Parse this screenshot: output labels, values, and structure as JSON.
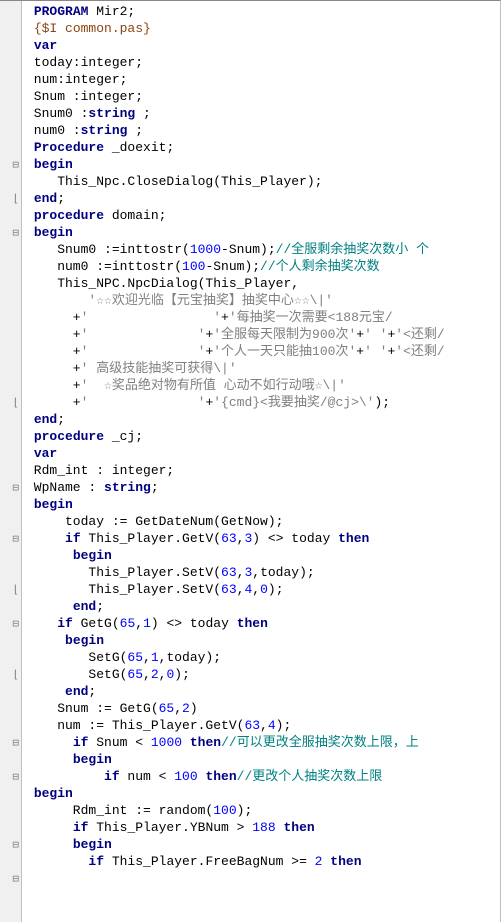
{
  "gutter": [
    "",
    "",
    "",
    "",
    "",
    "",
    "",
    "",
    "",
    "⊟",
    "",
    "⌊",
    "",
    "⊟",
    "",
    "",
    "",
    "",
    "",
    "",
    "",
    "",
    "",
    "⌊",
    "",
    "",
    "",
    "",
    "⊟",
    "",
    "",
    "⊟",
    "",
    "",
    "⌊",
    "",
    "⊟",
    "",
    "",
    "⌊",
    "",
    "",
    "",
    "⊟",
    "",
    "⊟",
    "",
    "",
    "",
    "⊟",
    "",
    "⊟"
  ],
  "lines": [
    [
      {
        "t": " ",
        "c": ""
      },
      {
        "t": "PROGRAM",
        "c": "kw"
      },
      {
        "t": " Mir2;",
        "c": "id"
      }
    ],
    [
      {
        "t": " ",
        "c": ""
      },
      {
        "t": "{$I common.pas}",
        "c": "dir"
      }
    ],
    [
      {
        "t": " ",
        "c": ""
      },
      {
        "t": "var",
        "c": "kw"
      }
    ],
    [
      {
        "t": " today:integer;",
        "c": "id"
      }
    ],
    [
      {
        "t": " num:integer;",
        "c": "id"
      }
    ],
    [
      {
        "t": " Snum :integer;",
        "c": "id"
      }
    ],
    [
      {
        "t": " Snum0 :",
        "c": "id"
      },
      {
        "t": "string",
        "c": "kw"
      },
      {
        "t": " ;",
        "c": "id"
      }
    ],
    [
      {
        "t": " num0 :",
        "c": "id"
      },
      {
        "t": "string",
        "c": "kw"
      },
      {
        "t": " ;",
        "c": "id"
      }
    ],
    [
      {
        "t": " ",
        "c": ""
      },
      {
        "t": "Procedure",
        "c": "kw"
      },
      {
        "t": " _doexit;",
        "c": "id"
      }
    ],
    [
      {
        "t": " ",
        "c": ""
      },
      {
        "t": "begin",
        "c": "kw"
      }
    ],
    [
      {
        "t": "    This_Npc.CloseDialog(This_Player);",
        "c": "id"
      }
    ],
    [
      {
        "t": " ",
        "c": ""
      },
      {
        "t": "end",
        "c": "kw"
      },
      {
        "t": ";",
        "c": "id"
      }
    ],
    [
      {
        "t": " ",
        "c": ""
      },
      {
        "t": "procedure",
        "c": "kw"
      },
      {
        "t": " domain;",
        "c": "id"
      }
    ],
    [
      {
        "t": " ",
        "c": ""
      },
      {
        "t": "begin",
        "c": "kw"
      }
    ],
    [
      {
        "t": "    Snum0 :=inttostr(",
        "c": "id"
      },
      {
        "t": "1000",
        "c": "num"
      },
      {
        "t": "-Snum);",
        "c": "id"
      },
      {
        "t": "//全服剩余抽奖次数小 个",
        "c": "cmt"
      }
    ],
    [
      {
        "t": "    num0 :=inttostr(",
        "c": "id"
      },
      {
        "t": "100",
        "c": "num"
      },
      {
        "t": "-Snum);",
        "c": "id"
      },
      {
        "t": "//个人剩余抽奖次数",
        "c": "cmt"
      }
    ],
    [
      {
        "t": "    This_NPC.NpcDialog(This_Player,",
        "c": "id"
      }
    ],
    [
      {
        "t": "        ",
        "c": ""
      },
      {
        "t": "'☆☆欢迎光临【元宝抽奖】抽奖中心☆☆\\|'",
        "c": "str"
      }
    ],
    [
      {
        "t": "      +",
        "c": "id"
      },
      {
        "t": "'                '",
        "c": "str"
      },
      {
        "t": "+",
        "c": "id"
      },
      {
        "t": "'每抽奖一次需要<188元宝/",
        "c": "str"
      }
    ],
    [
      {
        "t": "      +",
        "c": "id"
      },
      {
        "t": "'              '",
        "c": "str"
      },
      {
        "t": "+",
        "c": "id"
      },
      {
        "t": "'全服每天限制为900次'",
        "c": "str"
      },
      {
        "t": "+",
        "c": "id"
      },
      {
        "t": "' '",
        "c": "str"
      },
      {
        "t": "+",
        "c": "id"
      },
      {
        "t": "'<还剩/",
        "c": "str"
      }
    ],
    [
      {
        "t": "      +",
        "c": "id"
      },
      {
        "t": "'              '",
        "c": "str"
      },
      {
        "t": "+",
        "c": "id"
      },
      {
        "t": "'个人一天只能抽100次'",
        "c": "str"
      },
      {
        "t": "+",
        "c": "id"
      },
      {
        "t": "' '",
        "c": "str"
      },
      {
        "t": "+",
        "c": "id"
      },
      {
        "t": "'<还剩/",
        "c": "str"
      }
    ],
    [
      {
        "t": "      +",
        "c": "id"
      },
      {
        "t": "' 高级技能抽奖可获得\\|'",
        "c": "str"
      }
    ],
    [
      {
        "t": "      +",
        "c": "id"
      },
      {
        "t": "'  ☆奖品绝对物有所值 心动不如行动哦☆\\|'",
        "c": "str"
      }
    ],
    [
      {
        "t": "      +",
        "c": "id"
      },
      {
        "t": "'              '",
        "c": "str"
      },
      {
        "t": "+",
        "c": "id"
      },
      {
        "t": "'{cmd}<我要抽奖/@cj>\\'",
        "c": "str"
      },
      {
        "t": ");",
        "c": "id"
      }
    ],
    [
      {
        "t": " ",
        "c": ""
      },
      {
        "t": "end",
        "c": "kw"
      },
      {
        "t": ";",
        "c": "id"
      }
    ],
    [
      {
        "t": " ",
        "c": ""
      },
      {
        "t": "procedure",
        "c": "kw"
      },
      {
        "t": " _cj;",
        "c": "id"
      }
    ],
    [
      {
        "t": " ",
        "c": ""
      },
      {
        "t": "var",
        "c": "kw"
      }
    ],
    [
      {
        "t": " Rdm_int : integer;",
        "c": "id"
      }
    ],
    [
      {
        "t": " WpName : ",
        "c": "id"
      },
      {
        "t": "string",
        "c": "kw"
      },
      {
        "t": ";",
        "c": "id"
      }
    ],
    [
      {
        "t": " ",
        "c": ""
      },
      {
        "t": "begin",
        "c": "kw"
      }
    ],
    [
      {
        "t": "     today := GetDateNum(GetNow);",
        "c": "id"
      }
    ],
    [
      {
        "t": "     ",
        "c": ""
      },
      {
        "t": "if",
        "c": "kw"
      },
      {
        "t": " This_Player.GetV(",
        "c": "id"
      },
      {
        "t": "63",
        "c": "num"
      },
      {
        "t": ",",
        "c": "id"
      },
      {
        "t": "3",
        "c": "num"
      },
      {
        "t": ") <> today ",
        "c": "id"
      },
      {
        "t": "then",
        "c": "kw"
      }
    ],
    [
      {
        "t": "      ",
        "c": ""
      },
      {
        "t": "begin",
        "c": "kw"
      }
    ],
    [
      {
        "t": "        This_Player.SetV(",
        "c": "id"
      },
      {
        "t": "63",
        "c": "num"
      },
      {
        "t": ",",
        "c": "id"
      },
      {
        "t": "3",
        "c": "num"
      },
      {
        "t": ",today);",
        "c": "id"
      }
    ],
    [
      {
        "t": "        This_Player.SetV(",
        "c": "id"
      },
      {
        "t": "63",
        "c": "num"
      },
      {
        "t": ",",
        "c": "id"
      },
      {
        "t": "4",
        "c": "num"
      },
      {
        "t": ",",
        "c": "id"
      },
      {
        "t": "0",
        "c": "num"
      },
      {
        "t": ");",
        "c": "id"
      }
    ],
    [
      {
        "t": "      ",
        "c": ""
      },
      {
        "t": "end",
        "c": "kw"
      },
      {
        "t": ";",
        "c": "id"
      }
    ],
    [
      {
        "t": "    ",
        "c": ""
      },
      {
        "t": "if",
        "c": "kw"
      },
      {
        "t": " GetG(",
        "c": "id"
      },
      {
        "t": "65",
        "c": "num"
      },
      {
        "t": ",",
        "c": "id"
      },
      {
        "t": "1",
        "c": "num"
      },
      {
        "t": ") <> today ",
        "c": "id"
      },
      {
        "t": "then",
        "c": "kw"
      }
    ],
    [
      {
        "t": "     ",
        "c": ""
      },
      {
        "t": "begin",
        "c": "kw"
      }
    ],
    [
      {
        "t": "        SetG(",
        "c": "id"
      },
      {
        "t": "65",
        "c": "num"
      },
      {
        "t": ",",
        "c": "id"
      },
      {
        "t": "1",
        "c": "num"
      },
      {
        "t": ",today);",
        "c": "id"
      }
    ],
    [
      {
        "t": "        SetG(",
        "c": "id"
      },
      {
        "t": "65",
        "c": "num"
      },
      {
        "t": ",",
        "c": "id"
      },
      {
        "t": "2",
        "c": "num"
      },
      {
        "t": ",",
        "c": "id"
      },
      {
        "t": "0",
        "c": "num"
      },
      {
        "t": ");",
        "c": "id"
      }
    ],
    [
      {
        "t": "     ",
        "c": ""
      },
      {
        "t": "end",
        "c": "kw"
      },
      {
        "t": ";",
        "c": "id"
      }
    ],
    [
      {
        "t": "    Snum := GetG(",
        "c": "id"
      },
      {
        "t": "65",
        "c": "num"
      },
      {
        "t": ",",
        "c": "id"
      },
      {
        "t": "2",
        "c": "num"
      },
      {
        "t": ")",
        "c": "id"
      }
    ],
    [
      {
        "t": "    num := This_Player.GetV(",
        "c": "id"
      },
      {
        "t": "63",
        "c": "num"
      },
      {
        "t": ",",
        "c": "id"
      },
      {
        "t": "4",
        "c": "num"
      },
      {
        "t": ");",
        "c": "id"
      }
    ],
    [
      {
        "t": "      ",
        "c": ""
      },
      {
        "t": "if",
        "c": "kw"
      },
      {
        "t": " Snum < ",
        "c": "id"
      },
      {
        "t": "1000",
        "c": "num"
      },
      {
        "t": " ",
        "c": ""
      },
      {
        "t": "then",
        "c": "kw"
      },
      {
        "t": "//可以更改全服抽奖次数上限，上",
        "c": "cmt"
      }
    ],
    [
      {
        "t": "      ",
        "c": ""
      },
      {
        "t": "begin",
        "c": "kw"
      }
    ],
    [
      {
        "t": "          ",
        "c": ""
      },
      {
        "t": "if",
        "c": "kw"
      },
      {
        "t": " num < ",
        "c": "id"
      },
      {
        "t": "100",
        "c": "num"
      },
      {
        "t": " ",
        "c": ""
      },
      {
        "t": "then",
        "c": "kw"
      },
      {
        "t": "//更改个人抽奖次数上限",
        "c": "cmt"
      }
    ],
    [
      {
        "t": " ",
        "c": ""
      },
      {
        "t": "begin",
        "c": "kw"
      }
    ],
    [
      {
        "t": "      Rdm_int := random(",
        "c": "id"
      },
      {
        "t": "100",
        "c": "num"
      },
      {
        "t": ");",
        "c": "id"
      }
    ],
    [
      {
        "t": "      ",
        "c": ""
      },
      {
        "t": "if",
        "c": "kw"
      },
      {
        "t": " This_Player.YBNum > ",
        "c": "id"
      },
      {
        "t": "188",
        "c": "num"
      },
      {
        "t": " ",
        "c": ""
      },
      {
        "t": "then",
        "c": "kw"
      }
    ],
    [
      {
        "t": "      ",
        "c": ""
      },
      {
        "t": "begin",
        "c": "kw"
      }
    ],
    [
      {
        "t": "        ",
        "c": ""
      },
      {
        "t": "if",
        "c": "kw"
      },
      {
        "t": " This_Player.FreeBagNum >= ",
        "c": "id"
      },
      {
        "t": "2",
        "c": "num"
      },
      {
        "t": " ",
        "c": ""
      },
      {
        "t": "then",
        "c": "kw"
      }
    ],
    [
      {
        "t": "",
        "c": ""
      }
    ]
  ]
}
